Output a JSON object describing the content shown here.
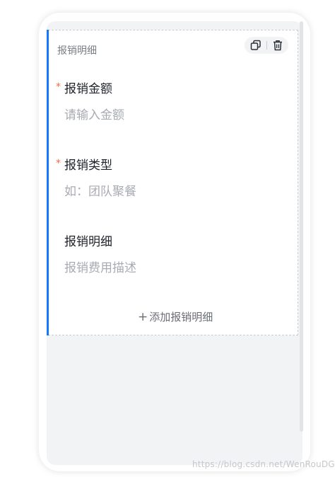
{
  "card": {
    "title": "报销明细",
    "actions": {
      "copy_icon": "copy-icon",
      "delete_icon": "trash-icon"
    }
  },
  "fields": [
    {
      "label": "报销金额",
      "placeholder": "请输入金额",
      "required": true
    },
    {
      "label": "报销类型",
      "placeholder": "如：团队聚餐",
      "required": true
    },
    {
      "label": "报销明细",
      "placeholder": "报销费用描述",
      "required": false
    }
  ],
  "required_mark": "*",
  "add_button": {
    "icon": "+",
    "label": "添加报销明细"
  },
  "watermark": "https://blog.csdn.net/WenRouDG",
  "colors": {
    "accent": "#1677ff",
    "required": "#f56c4a",
    "placeholder": "#a8abb2"
  }
}
